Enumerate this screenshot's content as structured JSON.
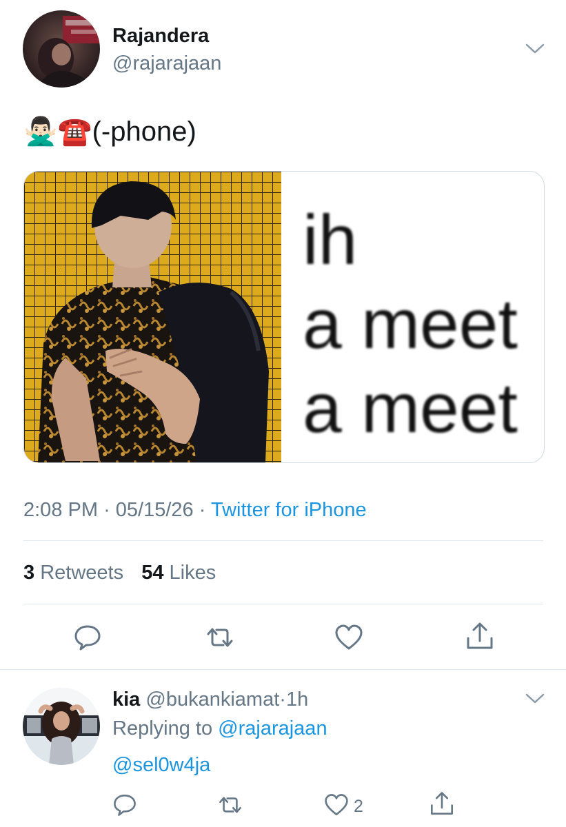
{
  "tweet": {
    "display_name": "Rajandera",
    "handle": "@rajarajaan",
    "text": "🙅🏻‍♂️☎️(-phone)",
    "media": {
      "meme_line_1": "ih",
      "meme_line_2": "a meet",
      "meme_line_3": "a meet"
    },
    "time": "2:08 PM",
    "dot_1": "·",
    "date": "05/15/26",
    "dot_2": "·",
    "source": "Twitter for iPhone",
    "retweets_count": "3",
    "retweets_label": "Retweets",
    "likes_count": "54",
    "likes_label": "Likes"
  },
  "reply": {
    "display_name": "kia",
    "handle": "@bukankiamat",
    "dot": "·",
    "time": "1h",
    "replying_prefix": "Replying to",
    "replying_to": "@rajarajaan",
    "mention": "@sel0w4ja",
    "like_count": "2"
  },
  "icons": {
    "reply": "reply-icon",
    "retweet": "retweet-icon",
    "like": "heart-icon",
    "share": "share-icon",
    "chevron": "chevron-down-icon"
  },
  "colors": {
    "link_blue": "#1b95e0",
    "secondary_gray": "#657786",
    "divider": "#e1e8ed",
    "photo_background_yellow": "#e0b020"
  }
}
